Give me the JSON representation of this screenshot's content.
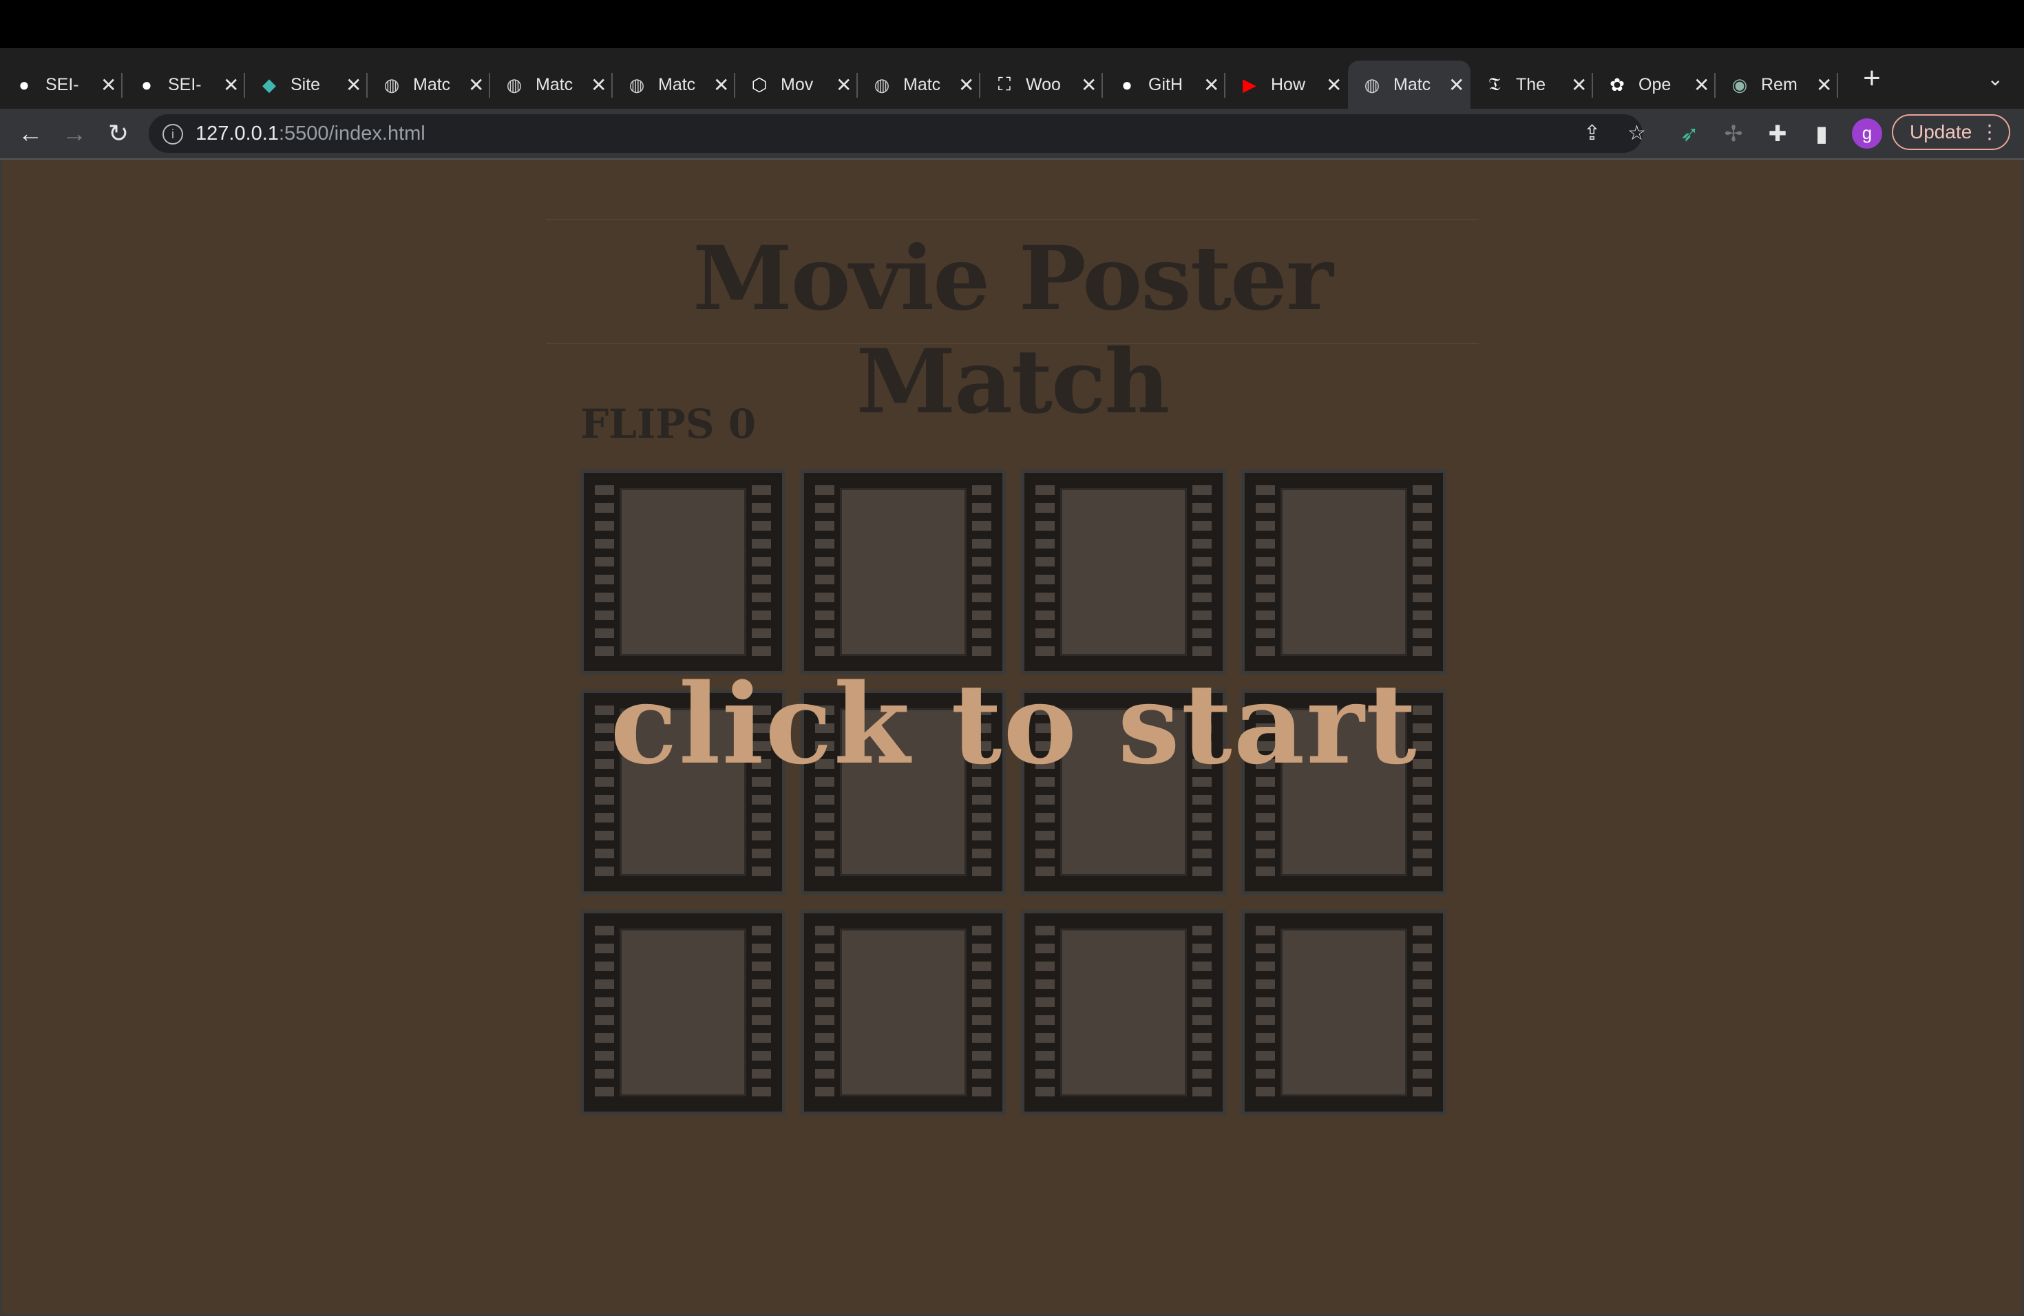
{
  "browser": {
    "tabs": [
      {
        "title": "SEI-",
        "icon": "github-icon"
      },
      {
        "title": "SEI-",
        "icon": "github-icon"
      },
      {
        "title": "Site",
        "icon": "diamond-icon"
      },
      {
        "title": "Matc",
        "icon": "globe-icon"
      },
      {
        "title": "Matc",
        "icon": "globe-icon"
      },
      {
        "title": "Matc",
        "icon": "globe-icon"
      },
      {
        "title": "Mov",
        "icon": "codepen-icon"
      },
      {
        "title": "Matc",
        "icon": "globe-icon"
      },
      {
        "title": "Woo",
        "icon": "frame-icon"
      },
      {
        "title": "GitH",
        "icon": "github-icon"
      },
      {
        "title": "How",
        "icon": "youtube-icon"
      },
      {
        "title": "Matc",
        "icon": "globe-icon"
      },
      {
        "title": "The",
        "icon": "nyt-icon"
      },
      {
        "title": "Ope",
        "icon": "openai-icon"
      },
      {
        "title": "Rem",
        "icon": "chatgpt-icon"
      }
    ],
    "url_host": "127.0.0.1",
    "url_rest": ":5500/index.html",
    "profile_initial": "g",
    "update_label": "Update"
  },
  "page": {
    "title": "Movie Poster Match",
    "flips_label": "FLIPS 0",
    "start_overlay": "click to start",
    "card_count": 12
  },
  "colors": {
    "page_bg": "#4a3a2c",
    "title_text": "#2b2622",
    "overlay_text": "#c89f7a"
  }
}
